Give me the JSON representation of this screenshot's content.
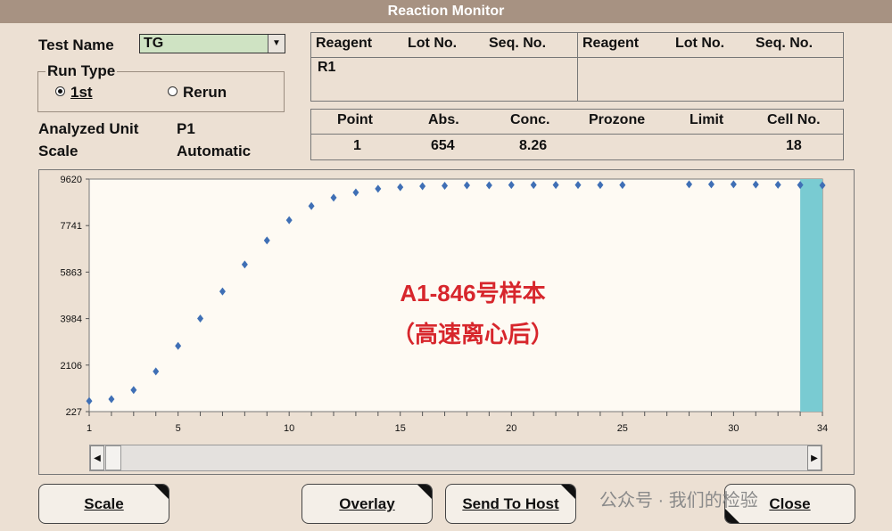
{
  "window": {
    "title": "Reaction Monitor"
  },
  "test_name": {
    "label": "Test Name",
    "value": "TG"
  },
  "run_type": {
    "label": "Run Type",
    "options": [
      "1st",
      "Rerun"
    ],
    "selected": "1st"
  },
  "analyzed_unit": {
    "label": "Analyzed Unit",
    "value": "P1"
  },
  "scale": {
    "label": "Scale",
    "value": "Automatic"
  },
  "reagent_table_left": {
    "headers": [
      "Reagent",
      "Lot No.",
      "Seq. No."
    ],
    "rows": [
      [
        "R1",
        "",
        ""
      ]
    ]
  },
  "reagent_table_right": {
    "headers": [
      "Reagent",
      "Lot No.",
      "Seq. No."
    ],
    "rows": []
  },
  "point_table": {
    "headers": [
      "Point",
      "Abs.",
      "Conc.",
      "Prozone",
      "Limit",
      "Cell No."
    ],
    "row": [
      "1",
      "654",
      "8.26",
      "",
      "",
      "18"
    ]
  },
  "chart_data": {
    "type": "scatter",
    "xlim": [
      1,
      34
    ],
    "ylim": [
      227,
      9620
    ],
    "x_ticks": [
      "1",
      "5",
      "10",
      "15",
      "20",
      "25",
      "30",
      "34"
    ],
    "y_ticks": [
      "9620",
      "7741",
      "5863",
      "3984",
      "2106",
      "227"
    ],
    "series": [
      {
        "color": "#3f6fb5",
        "x": [
          1,
          2,
          3,
          4,
          5,
          6,
          7,
          8,
          9,
          10,
          11,
          12,
          13,
          14,
          15,
          16,
          17,
          18,
          19,
          20,
          21,
          22,
          23,
          24,
          25,
          28,
          29,
          30,
          31,
          32,
          33,
          34
        ],
        "y": [
          654,
          730,
          1100,
          1850,
          2880,
          3990,
          5080,
          6170,
          7140,
          7960,
          8530,
          8870,
          9080,
          9230,
          9290,
          9330,
          9350,
          9370,
          9370,
          9380,
          9380,
          9380,
          9380,
          9380,
          9380,
          9410,
          9410,
          9410,
          9400,
          9390,
          9380,
          9370
        ]
      }
    ],
    "highlight_x": 33.5,
    "highlight_color": "#79cbd2",
    "annotation_lines": [
      "A1-846号样本",
      "（高速离心后）"
    ],
    "annotation_color": "#d7262c"
  },
  "buttons": {
    "scale": "Scale",
    "overlay": "Overlay",
    "send_to_host": "Send To Host",
    "close": "Close"
  },
  "watermark": "公众号 · 我们的检验"
}
